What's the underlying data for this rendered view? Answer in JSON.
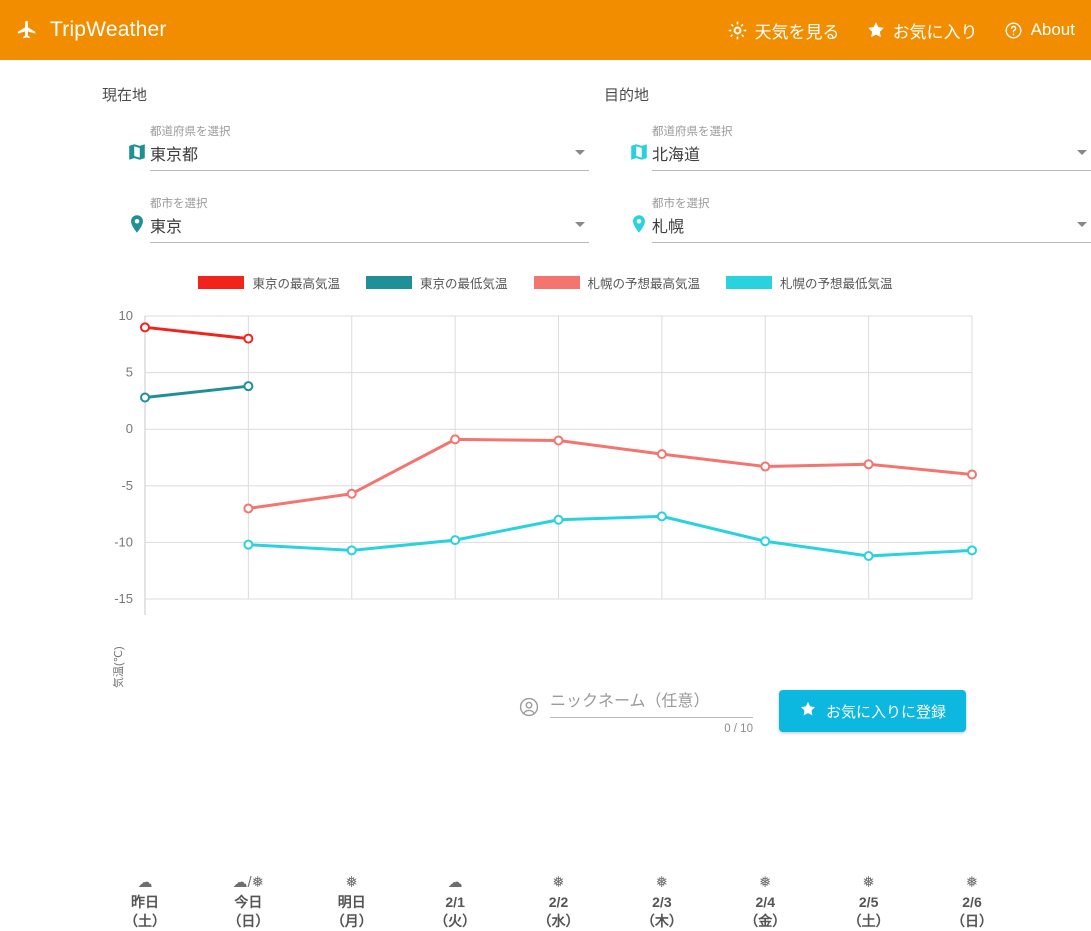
{
  "header": {
    "brand": "TripWeather",
    "brand_icon": "airplane-icon",
    "accent_color": "#f38d00",
    "nav": [
      {
        "label": "天気を見る",
        "icon": "sun-gear-icon"
      },
      {
        "label": "お気に入り",
        "icon": "star-icon"
      },
      {
        "label": "About",
        "icon": "question-circle-icon"
      }
    ]
  },
  "origin": {
    "title": "現在地",
    "prefecture": {
      "label": "都道府県を選択",
      "value": "東京都",
      "icon": "map-icon",
      "icon_color": "#1f9098"
    },
    "city": {
      "label": "都市を選択",
      "value": "東京",
      "icon": "location-pin-icon",
      "icon_color": "#1f9098"
    }
  },
  "destination": {
    "title": "目的地",
    "prefecture": {
      "label": "都道府県を選択",
      "value": "北海道",
      "icon": "map-icon",
      "icon_color": "#2ad2e0"
    },
    "city": {
      "label": "都市を選択",
      "value": "札幌",
      "icon": "location-pin-icon",
      "icon_color": "#2ad2e0"
    }
  },
  "footer": {
    "nickname_icon": "account-circle-icon",
    "nickname_placeholder": "ニックネーム（任意）",
    "nickname_value": "",
    "counter": "0 / 10",
    "fav_button_label": "お気に入りに登録",
    "fav_button_icon": "star-icon",
    "fav_button_color": "#0cb7e0"
  },
  "chart_data": {
    "type": "line",
    "title": "",
    "xlabel": "",
    "ylabel": "気温(℃)",
    "ylim": [
      -15,
      10
    ],
    "yticks": [
      10,
      5,
      0,
      -5,
      -10,
      -15
    ],
    "grid": true,
    "legend_position": "top",
    "categories": [
      {
        "day": "昨日",
        "weekday": "（土）",
        "weather": "cloud"
      },
      {
        "day": "今日",
        "weekday": "（日）",
        "weather": "cloud-snow"
      },
      {
        "day": "明日",
        "weekday": "（月）",
        "weather": "snow"
      },
      {
        "day": "2/1",
        "weekday": "（火）",
        "weather": "cloud"
      },
      {
        "day": "2/2",
        "weekday": "（水）",
        "weather": "snow"
      },
      {
        "day": "2/3",
        "weekday": "（木）",
        "weather": "snow"
      },
      {
        "day": "2/4",
        "weekday": "（金）",
        "weather": "snow"
      },
      {
        "day": "2/5",
        "weekday": "（土）",
        "weather": "snow"
      },
      {
        "day": "2/6",
        "weekday": "（日）",
        "weather": "snow"
      }
    ],
    "series": [
      {
        "name": "東京の最高気温",
        "color": "#f2231b",
        "values": [
          9.0,
          8.0,
          null,
          null,
          null,
          null,
          null,
          null,
          null
        ]
      },
      {
        "name": "東京の最低気温",
        "color": "#1f9098",
        "values": [
          2.8,
          3.8,
          null,
          null,
          null,
          null,
          null,
          null,
          null
        ]
      },
      {
        "name": "札幌の予想最高気温",
        "color": "#f4756f",
        "values": [
          null,
          -7.0,
          -5.7,
          -0.9,
          -1.0,
          -2.2,
          -3.3,
          -3.1,
          -4.0
        ]
      },
      {
        "name": "札幌の予想最低気温",
        "color": "#2ad2e0",
        "values": [
          null,
          -10.2,
          -10.7,
          -9.8,
          -8.0,
          -7.7,
          -9.9,
          -11.2,
          -10.7
        ]
      }
    ]
  }
}
